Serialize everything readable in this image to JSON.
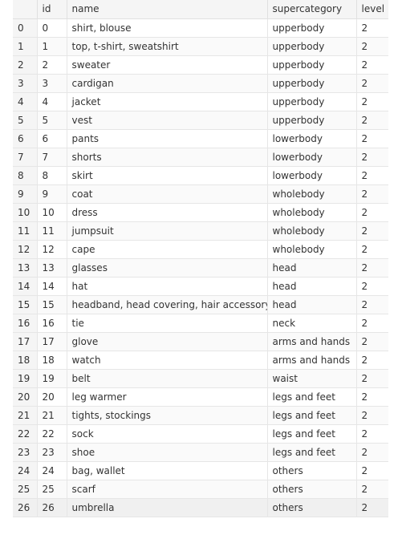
{
  "table": {
    "columns": [
      "",
      "id",
      "name",
      "supercategory",
      "level"
    ],
    "rows": [
      [
        "0",
        "0",
        "shirt, blouse",
        "upperbody",
        "2"
      ],
      [
        "1",
        "1",
        "top, t-shirt, sweatshirt",
        "upperbody",
        "2"
      ],
      [
        "2",
        "2",
        "sweater",
        "upperbody",
        "2"
      ],
      [
        "3",
        "3",
        "cardigan",
        "upperbody",
        "2"
      ],
      [
        "4",
        "4",
        "jacket",
        "upperbody",
        "2"
      ],
      [
        "5",
        "5",
        "vest",
        "upperbody",
        "2"
      ],
      [
        "6",
        "6",
        "pants",
        "lowerbody",
        "2"
      ],
      [
        "7",
        "7",
        "shorts",
        "lowerbody",
        "2"
      ],
      [
        "8",
        "8",
        "skirt",
        "lowerbody",
        "2"
      ],
      [
        "9",
        "9",
        "coat",
        "wholebody",
        "2"
      ],
      [
        "10",
        "10",
        "dress",
        "wholebody",
        "2"
      ],
      [
        "11",
        "11",
        "jumpsuit",
        "wholebody",
        "2"
      ],
      [
        "12",
        "12",
        "cape",
        "wholebody",
        "2"
      ],
      [
        "13",
        "13",
        "glasses",
        "head",
        "2"
      ],
      [
        "14",
        "14",
        "hat",
        "head",
        "2"
      ],
      [
        "15",
        "15",
        "headband, head covering, hair accessory",
        "head",
        "2"
      ],
      [
        "16",
        "16",
        "tie",
        "neck",
        "2"
      ],
      [
        "17",
        "17",
        "glove",
        "arms and hands",
        "2"
      ],
      [
        "18",
        "18",
        "watch",
        "arms and hands",
        "2"
      ],
      [
        "19",
        "19",
        "belt",
        "waist",
        "2"
      ],
      [
        "20",
        "20",
        "leg warmer",
        "legs and feet",
        "2"
      ],
      [
        "21",
        "21",
        "tights, stockings",
        "legs and feet",
        "2"
      ],
      [
        "22",
        "22",
        "sock",
        "legs and feet",
        "2"
      ],
      [
        "23",
        "23",
        "shoe",
        "legs and feet",
        "2"
      ],
      [
        "24",
        "24",
        "bag, wallet",
        "others",
        "2"
      ],
      [
        "25",
        "25",
        "scarf",
        "others",
        "2"
      ],
      [
        "26",
        "26",
        "umbrella",
        "others",
        "2"
      ]
    ]
  }
}
